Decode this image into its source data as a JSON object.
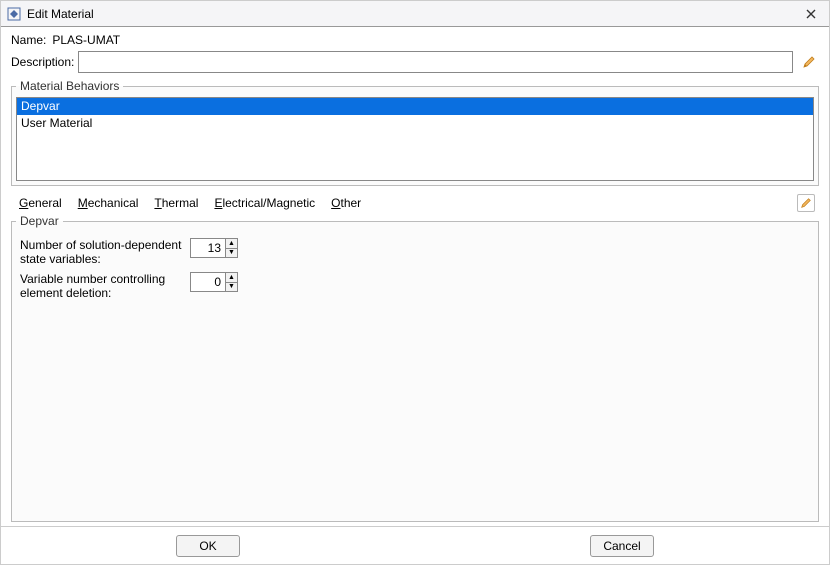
{
  "window": {
    "title": "Edit Material"
  },
  "name": {
    "label": "Name:",
    "value": "PLAS-UMAT"
  },
  "description": {
    "label": "Description:",
    "value": "",
    "placeholder": ""
  },
  "behaviors": {
    "legend": "Material Behaviors",
    "items": [
      {
        "label": "Depvar",
        "selected": true
      },
      {
        "label": "User Material",
        "selected": false
      }
    ]
  },
  "menus": {
    "general": {
      "accel": "G",
      "rest": "eneral"
    },
    "mechanical": {
      "accel": "M",
      "rest": "echanical"
    },
    "thermal": {
      "accel": "T",
      "rest": "hermal"
    },
    "electrical": {
      "accel": "E",
      "rest": "lectrical/Magnetic"
    },
    "other": {
      "accel": "O",
      "rest": "ther"
    }
  },
  "depvar": {
    "legend": "Depvar",
    "numVarsLabel": "Number of solution-dependent state variables:",
    "numVarsValue": "13",
    "delVarLabel": "Variable number controlling element deletion:",
    "delVarValue": "0"
  },
  "footer": {
    "ok": "OK",
    "cancel": "Cancel"
  }
}
